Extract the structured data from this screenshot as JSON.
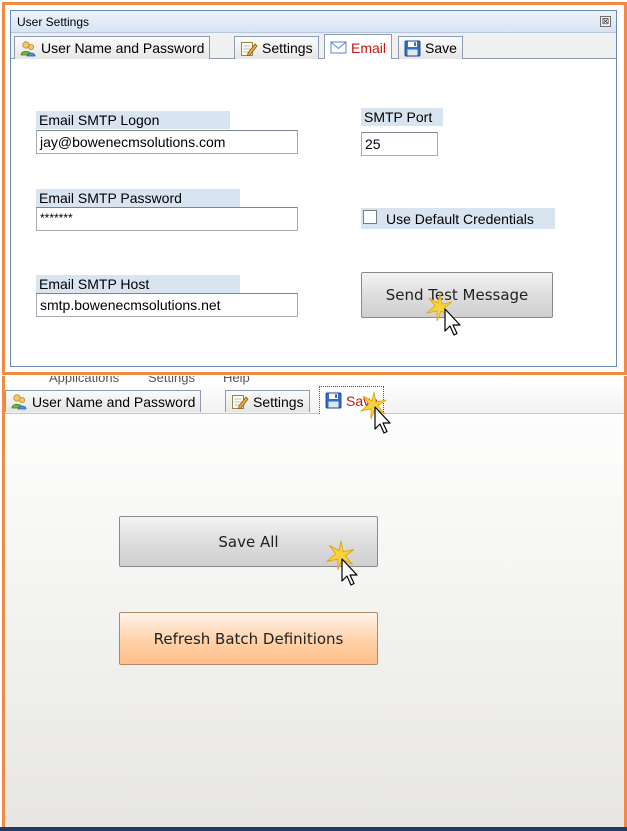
{
  "top_dialog": {
    "title": "User Settings",
    "close_glyph": "⊠",
    "tabs": [
      {
        "label": "User Name and Password",
        "icon": "users-icon"
      },
      {
        "label": "Settings",
        "icon": "notepad-pencil-icon"
      },
      {
        "label": "Email",
        "icon": "envelope-icon",
        "active": true
      },
      {
        "label": "Save",
        "icon": "floppy-disk-icon"
      }
    ],
    "fields": {
      "smtp_logon_label": "Email SMTP Logon",
      "smtp_logon_value": "jay@bowenecmsolutions.com",
      "smtp_password_label": "Email SMTP Password",
      "smtp_password_value": "*******",
      "smtp_host_label": "Email SMTP Host",
      "smtp_host_value": "smtp.bowenecmsolutions.net",
      "smtp_port_label": "SMTP Port",
      "smtp_port_value": "25",
      "use_default_credentials_label": "Use Default Credentials",
      "use_default_credentials_checked": false
    },
    "send_test_button": "Send Test Message"
  },
  "bottom_panel": {
    "menu": [
      "Applications",
      "Settings",
      "Help"
    ],
    "tabs": [
      {
        "label": "User Name and Password",
        "icon": "users-icon"
      },
      {
        "label": "Settings",
        "icon": "notepad-pencil-icon"
      },
      {
        "label": "Save",
        "icon": "floppy-disk-icon",
        "active": true
      }
    ],
    "save_all_button": "Save All",
    "refresh_button": "Refresh Batch Definitions"
  },
  "colors": {
    "frame_accent": "#f08a45",
    "label_highlight": "#d9e4f1",
    "active_tab_text": "#cc1111",
    "sparkle": "#f5c518",
    "bottom_bar": "#1d3c66"
  }
}
